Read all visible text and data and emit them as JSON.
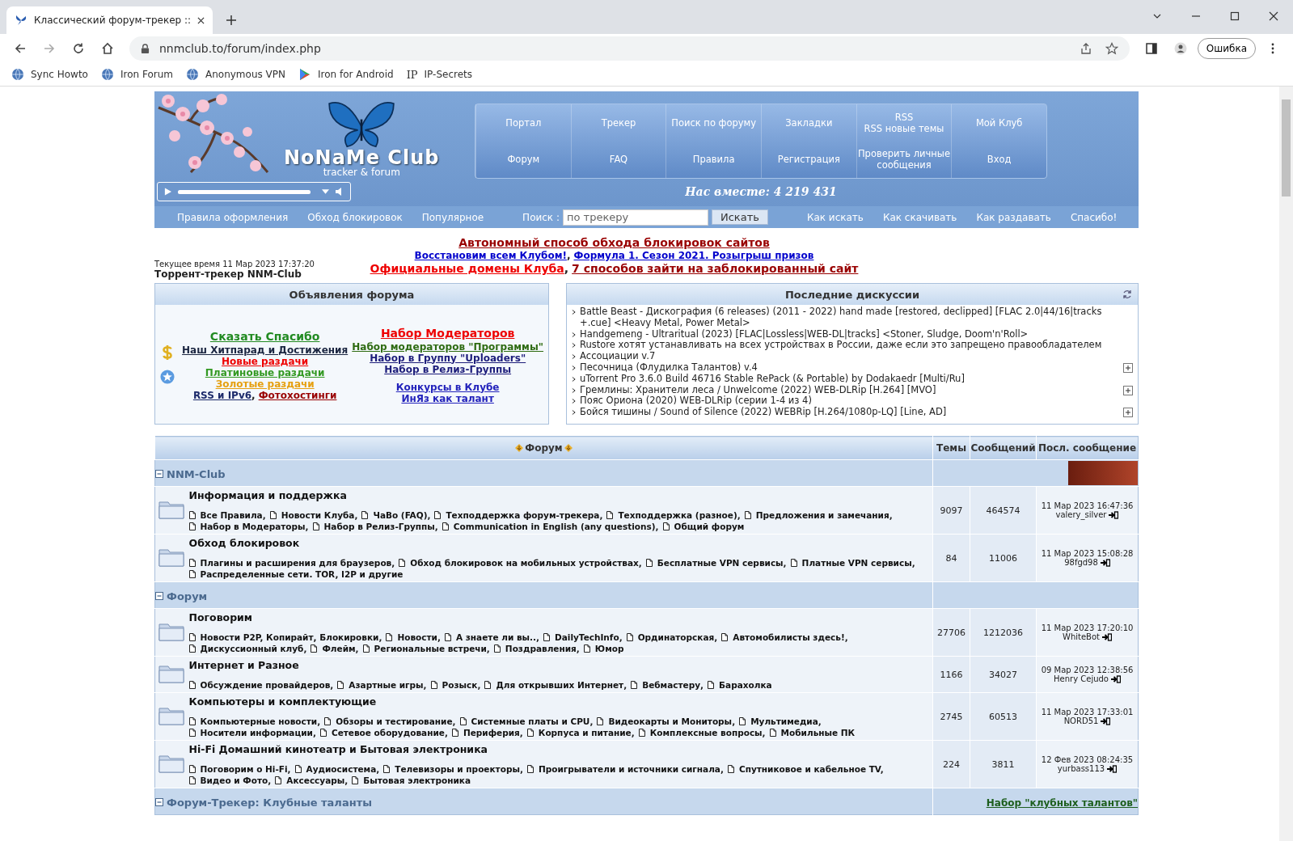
{
  "browser": {
    "tab_title": "Классический форум-трекер ::",
    "address": "nnmclub.to/forum/index.php",
    "profile_button": "Ошибка",
    "bookmarks": [
      {
        "kind": "globe",
        "label": "Sync Howto"
      },
      {
        "kind": "globe",
        "label": "Iron Forum"
      },
      {
        "kind": "globe",
        "label": "Anonymous VPN"
      },
      {
        "kind": "play",
        "label": "Iron for Android"
      },
      {
        "kind": "text",
        "icon": "IP",
        "label": "IP-Secrets"
      }
    ]
  },
  "header": {
    "logo_title": "NoNaMe Club",
    "logo_subtitle": "tracker & forum",
    "player": {
      "level": 1
    },
    "nav": [
      {
        "lines": [
          "Портал"
        ]
      },
      {
        "lines": [
          "Трекер"
        ]
      },
      {
        "lines": [
          "Поиск по форуму"
        ]
      },
      {
        "lines": [
          "Закладки"
        ]
      },
      {
        "lines": [
          "RSS",
          "RSS новые темы"
        ]
      },
      {
        "lines": [
          "Мой Клуб"
        ]
      },
      {
        "lines": [
          "Форум"
        ]
      },
      {
        "lines": [
          "FAQ"
        ]
      },
      {
        "lines": [
          "Правила"
        ]
      },
      {
        "lines": [
          "Регистрация"
        ]
      },
      {
        "lines": [
          "Проверить личные",
          "сообщения"
        ]
      },
      {
        "lines": [
          "Вход"
        ]
      }
    ],
    "members": "Нас вместе: 4 219 431"
  },
  "toolbar": {
    "left_links": [
      "Правила оформления",
      "Обход блокировок",
      "Популярное"
    ],
    "search_label": "Поиск :",
    "search": {
      "placeholder": "по трекеру"
    },
    "search_button": "Искать",
    "right_links": [
      "Как искать",
      "Как скачивать",
      "Как раздавать",
      "Спасибо!"
    ]
  },
  "info": {
    "time": "Текущее время 11 Мар 2023 17:37:20",
    "site": "Торрент-трекер NNM-Club",
    "announcements": [
      {
        "large": true,
        "links": [
          {
            "text": "Автономный способ обхода блокировок сайтов",
            "color": "#990000"
          }
        ]
      },
      {
        "large": false,
        "sep": ",",
        "links": [
          {
            "text": "Восстановим всем Клубом!",
            "color": "#0000cc"
          },
          {
            "text": "Формула 1. Сезон 2021. Розыгрыш призов",
            "color": "#0000cc"
          }
        ]
      },
      {
        "large": true,
        "sep": ",",
        "links": [
          {
            "text": "Официальные домены Клуба",
            "color": "#ee0000"
          },
          {
            "text": "7 способов зайти на заблокированный сайт",
            "color": "#990000"
          }
        ]
      }
    ]
  },
  "forum_news": {
    "title": "Объявления форума",
    "left": [
      {
        "large": true,
        "links": [
          {
            "text": "Сказать Спасибо",
            "color": "#228b22"
          }
        ]
      },
      {
        "large": false,
        "links": [
          {
            "text": "Наш Хитпарад и Достижения",
            "color": "#1a2540"
          }
        ]
      },
      {
        "large": false,
        "links": [
          {
            "text": "Новые раздачи",
            "color": "#ee0000"
          }
        ]
      },
      {
        "large": false,
        "links": [
          {
            "text": "Платиновые раздачи",
            "color": "#339922"
          }
        ]
      },
      {
        "large": false,
        "links": [
          {
            "text": "Золотые раздачи",
            "color": "#e6a010"
          }
        ]
      },
      {
        "large": false,
        "sep": ",",
        "links": [
          {
            "text": "RSS и IPv6",
            "color": "#1c2a6a"
          },
          {
            "text": "Фотохостинги",
            "color": "#990000"
          }
        ]
      }
    ],
    "right": [
      {
        "large": true,
        "links": [
          {
            "text": "Набор Модераторов",
            "color": "#ee0000"
          }
        ]
      },
      {
        "large": false,
        "links": [
          {
            "text": "Набор модераторов \"Программы\"",
            "color": "#2e6b12"
          }
        ]
      },
      {
        "large": false,
        "links": [
          {
            "text": "Набор в Группу \"Uploaders\"",
            "color": "#1c1c7a"
          }
        ]
      },
      {
        "large": false,
        "links": [
          {
            "text": "Набор в Релиз-Группы",
            "color": "#1c1c7a"
          }
        ]
      },
      {
        "large": false,
        "links": [
          {
            "text": "Конкурсы в Клубе",
            "color": "#2222bb"
          }
        ]
      },
      {
        "large": false,
        "links": [
          {
            "text": "ИнЯз как талант",
            "color": "#2222bb"
          }
        ]
      }
    ]
  },
  "discussions": {
    "title": "Последние дискуссии",
    "items": [
      {
        "text": "Battle Beast - Дискография (6 releases) (2011 - 2022) hand made [restored, declipped] [FLAC 2.0|44/16|tracks +.cue] <Heavy Metal, Power Metal>",
        "expand": false
      },
      {
        "text": "Handgemeng - Ultraritual (2023) [FLAC|Lossless|WEB-DL|tracks] <Stoner, Sludge, Doom'n'Roll>",
        "expand": false
      },
      {
        "text": "Rustore хотят устанавливать на всех устройствах в России, даже если это запрещено правообладателем",
        "expand": false
      },
      {
        "text": "Ассоциации v.7",
        "expand": false
      },
      {
        "text": "Песочница (Флудилка Талантов) v.4",
        "expand": true
      },
      {
        "text": "uTorrent Pro 3.6.0 Build 46716 Stable RePack (& Portable) by Dodakaedr [Multi/Ru]",
        "expand": false
      },
      {
        "text": "Гремлины: Хранители леса / Unwelcome (2022) WEB-DLRip [H.264] [MVO]",
        "expand": true
      },
      {
        "text": "Пояс Ориона (2020) WEB-DLRip (серии 1-4 из 4)",
        "expand": false
      },
      {
        "text": "Бойся тишины / Sound of Silence (2022) WEBRip [H.264/1080p-LQ] [Line, AD]",
        "expand": true
      }
    ]
  },
  "table": {
    "columns": [
      "Форум",
      "Темы",
      "Сообщений",
      "Посл. сообщение"
    ],
    "categories": [
      {
        "name": "NNM-Club",
        "expanded": true,
        "side": {
          "kind": "banner"
        },
        "forums": [
          {
            "title": "Информация и поддержка",
            "sep": ",",
            "subforums": [
              "Все Правила",
              "Новости Клуба",
              "ЧаВо (FAQ)",
              "Техподдержка форум-трекера",
              "Техподдержка (разное)",
              "Предложения и замечания",
              "Набор в Модераторы",
              "Набор в Релиз-Группы",
              "Communication in English (any questions)",
              "Общий форум"
            ],
            "topics": "9097",
            "posts": "464574",
            "last_date": "11 Мар 2023 16:47:36",
            "last_user": "valery_silver"
          },
          {
            "title": "Обход блокировок",
            "sep": ",",
            "subforums": [
              "Плагины и расширения для браузеров",
              "Обход блокировок на мобильных устройствах",
              "Бесплатные VPN сервисы",
              "Платные VPN сервисы",
              "Распределенные сети. TOR, I2P и другие"
            ],
            "topics": "84",
            "posts": "11006",
            "last_date": "11 Мар 2023 15:08:28",
            "last_user": "98fgd98"
          }
        ]
      },
      {
        "name": "Форум",
        "expanded": true,
        "side": {
          "kind": "none"
        },
        "forums": [
          {
            "title": "Поговорим",
            "sep": ",",
            "subforums": [
              "Новости P2P, Копирайт, Блокировки",
              "Новости",
              "А знаете ли вы..",
              "DailyTechInfo",
              "Ординаторская",
              "Автомобилисты здесь!",
              "Дискуссионный клуб",
              "Флейм",
              "Региональные встречи",
              "Поздравления",
              "Юмор"
            ],
            "topics": "27706",
            "posts": "1212036",
            "last_date": "11 Мар 2023 17:20:10",
            "last_user": "WhiteBot"
          },
          {
            "title": "Интернет и Разное",
            "sep": ",",
            "subforums": [
              "Обсуждение провайдеров",
              "Азартные игры",
              "Розыск",
              "Для открывших Интернет",
              "Вебмастеру",
              "Барахолка"
            ],
            "topics": "1166",
            "posts": "34027",
            "last_date": "09 Мар 2023 12:38:56",
            "last_user": "Henry Cejudo"
          },
          {
            "title": "Компьютеры и комплектующие",
            "sep": ",",
            "subforums": [
              "Компьютерные новости",
              "Обзоры и тестирование",
              "Системные платы и CPU",
              "Видеокарты и Мониторы",
              "Мультимедиа",
              "Носители информации",
              "Сетевое оборудование",
              "Периферия",
              "Корпуса и питание",
              "Комплексные вопросы",
              "Мобильные ПК"
            ],
            "topics": "2745",
            "posts": "60513",
            "last_date": "11 Мар 2023 17:33:01",
            "last_user": "NORD51"
          },
          {
            "title": "Hi-Fi Домашний кинотеатр и Бытовая электроника",
            "sep": ",",
            "subforums": [
              "Поговорим о Hi-Fi",
              "Аудиосистема",
              "Телевизоры и проекторы",
              "Проигрыватели и источники сигнала",
              "Спутниковое и кабельное TV",
              "Видео и Фото",
              "Аксессуары",
              "Бытовая электроника"
            ],
            "topics": "224",
            "posts": "3811",
            "last_date": "12 Фев 2023 08:24:35",
            "last_user": "yurbass113"
          }
        ]
      },
      {
        "name": "Форум-Трекер: Клубные таланты",
        "expanded": true,
        "side": {
          "kind": "link",
          "text": "Набор \"клубных талантов\""
        }
      }
    ]
  }
}
